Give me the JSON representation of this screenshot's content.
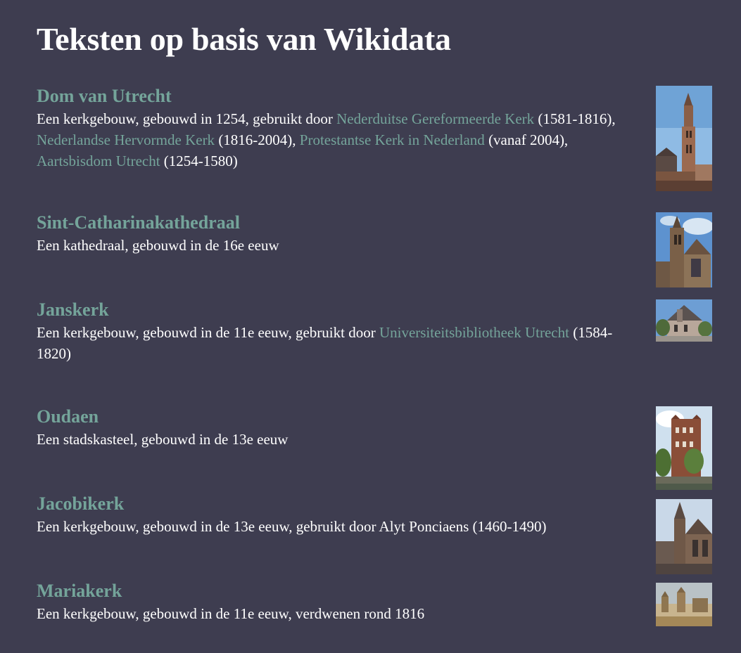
{
  "page": {
    "title": "Teksten op basis van Wikidata"
  },
  "colors": {
    "background": "#3e3d50",
    "link": "#74a49a",
    "text": "#ffffff"
  },
  "entries": [
    {
      "title": "Dom van Utrecht",
      "desc_1": "Een kerkgebouw, gebouwd in 1254, gebruikt door ",
      "link_1": "Nederduitse Gereformeerde Kerk",
      "desc_2": " (1581-1816), ",
      "link_2": "Nederlandse Hervormde Kerk",
      "desc_3": " (1816-2004), ",
      "link_3": "Protestantse Kerk in Nederland",
      "desc_4": " (vanaf 2004), ",
      "link_4": "Aartsbisdom Utrecht",
      "desc_5": " (1254-1580)",
      "image": "photo-dom-tower"
    },
    {
      "title": "Sint-Catharinakathedraal",
      "desc_1": "Een kathedraal, gebouwd in de 16e eeuw",
      "image": "photo-cathedral"
    },
    {
      "title": "Janskerk",
      "desc_1": "Een kerkgebouw, gebouwd in de 11e eeuw, gebruikt door ",
      "link_1": "Universiteitsbibliotheek Utrecht",
      "desc_2": " (1584-1820)",
      "image": "photo-janskerk"
    },
    {
      "title": "Oudaen",
      "desc_1": "Een stadskasteel, gebouwd in de 13e eeuw",
      "image": "photo-oudaen"
    },
    {
      "title": "Jacobikerk",
      "desc_1": "Een kerkgebouw, gebouwd in de 13e eeuw, gebruikt door Alyt Ponciaens (1460-1490)",
      "image": "photo-jacobikerk"
    },
    {
      "title": "Mariakerk",
      "desc_1": "Een kerkgebouw, gebouwd in de 11e eeuw, verdwenen rond 1816",
      "image": "photo-mariakerk"
    }
  ]
}
